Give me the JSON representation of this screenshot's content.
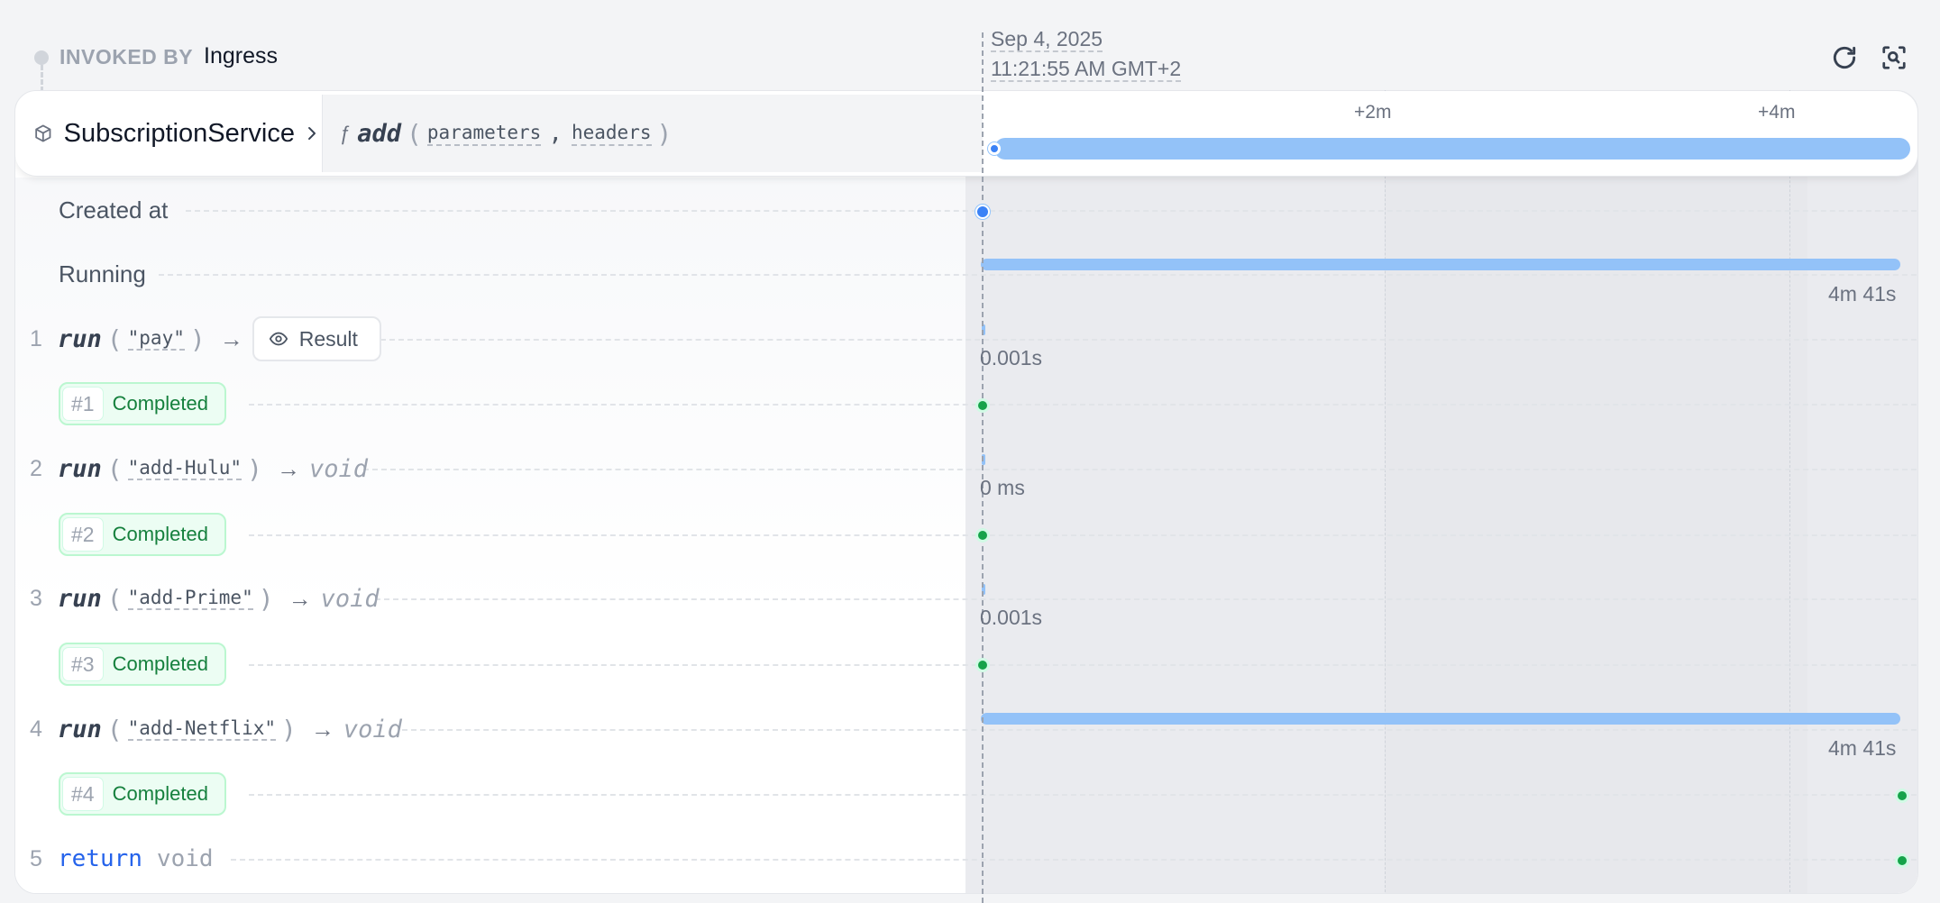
{
  "header": {
    "invoked_by_label": "INVOKED BY",
    "invoked_by_value": "Ingress",
    "date": "Sep 4, 2025",
    "time": "11:21:55 AM GMT+2",
    "refresh_icon": "refresh-icon",
    "zoom_icon": "zoom-search-icon"
  },
  "service": {
    "name": "SubscriptionService",
    "function_icon": "ƒ",
    "function_name": "add",
    "open_paren": "(",
    "close_paren": ")",
    "params": [
      "parameters",
      "headers"
    ],
    "comma": ","
  },
  "timeline": {
    "ticks": [
      "+2m",
      "+4m"
    ]
  },
  "rows": {
    "created_at": "Created at",
    "running": {
      "label": "Running",
      "duration": "4m 41s"
    },
    "steps": [
      {
        "index": "1",
        "keyword": "run",
        "arg": "\"pay\"",
        "arrow": "→",
        "result_label": "Result",
        "duration": "0.001s",
        "attempt": "#1",
        "status": "Completed"
      },
      {
        "index": "2",
        "keyword": "run",
        "arg": "\"add-Hulu\"",
        "arrow": "→",
        "returns": "void",
        "duration": "0 ms",
        "attempt": "#2",
        "status": "Completed"
      },
      {
        "index": "3",
        "keyword": "run",
        "arg": "\"add-Prime\"",
        "arrow": "→",
        "returns": "void",
        "duration": "0.001s",
        "attempt": "#3",
        "status": "Completed"
      },
      {
        "index": "4",
        "keyword": "run",
        "arg": "\"add-Netflix\"",
        "arrow": "→",
        "returns": "void",
        "duration": "4m 41s",
        "attempt": "#4",
        "status": "Completed"
      }
    ],
    "return": {
      "index": "5",
      "keyword": "return",
      "value": "void"
    }
  }
}
